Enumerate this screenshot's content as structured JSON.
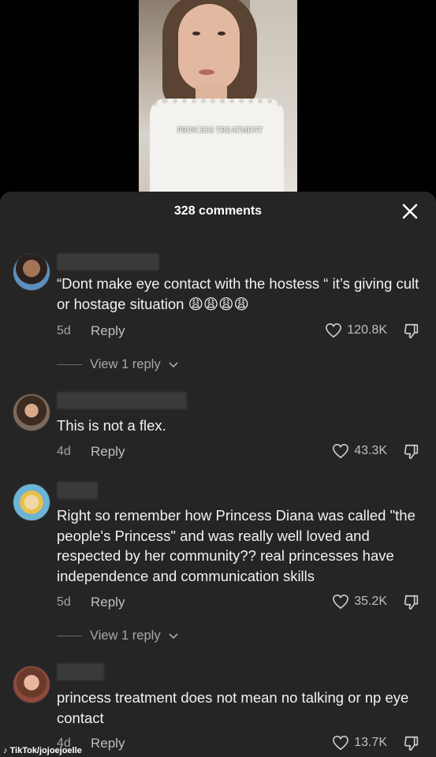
{
  "video": {
    "caption": "PRINCESS TREATMENT"
  },
  "sheet": {
    "title": "328 comments"
  },
  "comments": [
    {
      "text": "“Dont make eye contact with the hostess “ it’s giving cult or hostage situation 😩😩😩😩",
      "age": "5d",
      "reply_label": "Reply",
      "likes": "120.8K",
      "view_replies": "View 1 reply"
    },
    {
      "text": "This is not a flex.",
      "age": "4d",
      "reply_label": "Reply",
      "likes": "43.3K"
    },
    {
      "text": "Right so remember how Princess Diana was called \"the people's Princess\" and was really well loved and respected by her community?? real princesses have independence and communication skills",
      "age": "5d",
      "reply_label": "Reply",
      "likes": "35.2K",
      "view_replies": "View 1 reply"
    },
    {
      "text": "princess treatment does not mean no talking or np eye contact",
      "age": "4d",
      "reply_label": "Reply",
      "likes": "13.7K"
    }
  ],
  "watermark": "TikTok/jojoejoelle",
  "icons": {
    "close": "close-icon",
    "like": "heart-icon",
    "dislike": "thumbs-down-icon",
    "chevron": "chevron-down-icon"
  },
  "colors": {
    "sheet": "#252525",
    "text": "#f2f2f2",
    "muted": "#a3a3a3"
  }
}
